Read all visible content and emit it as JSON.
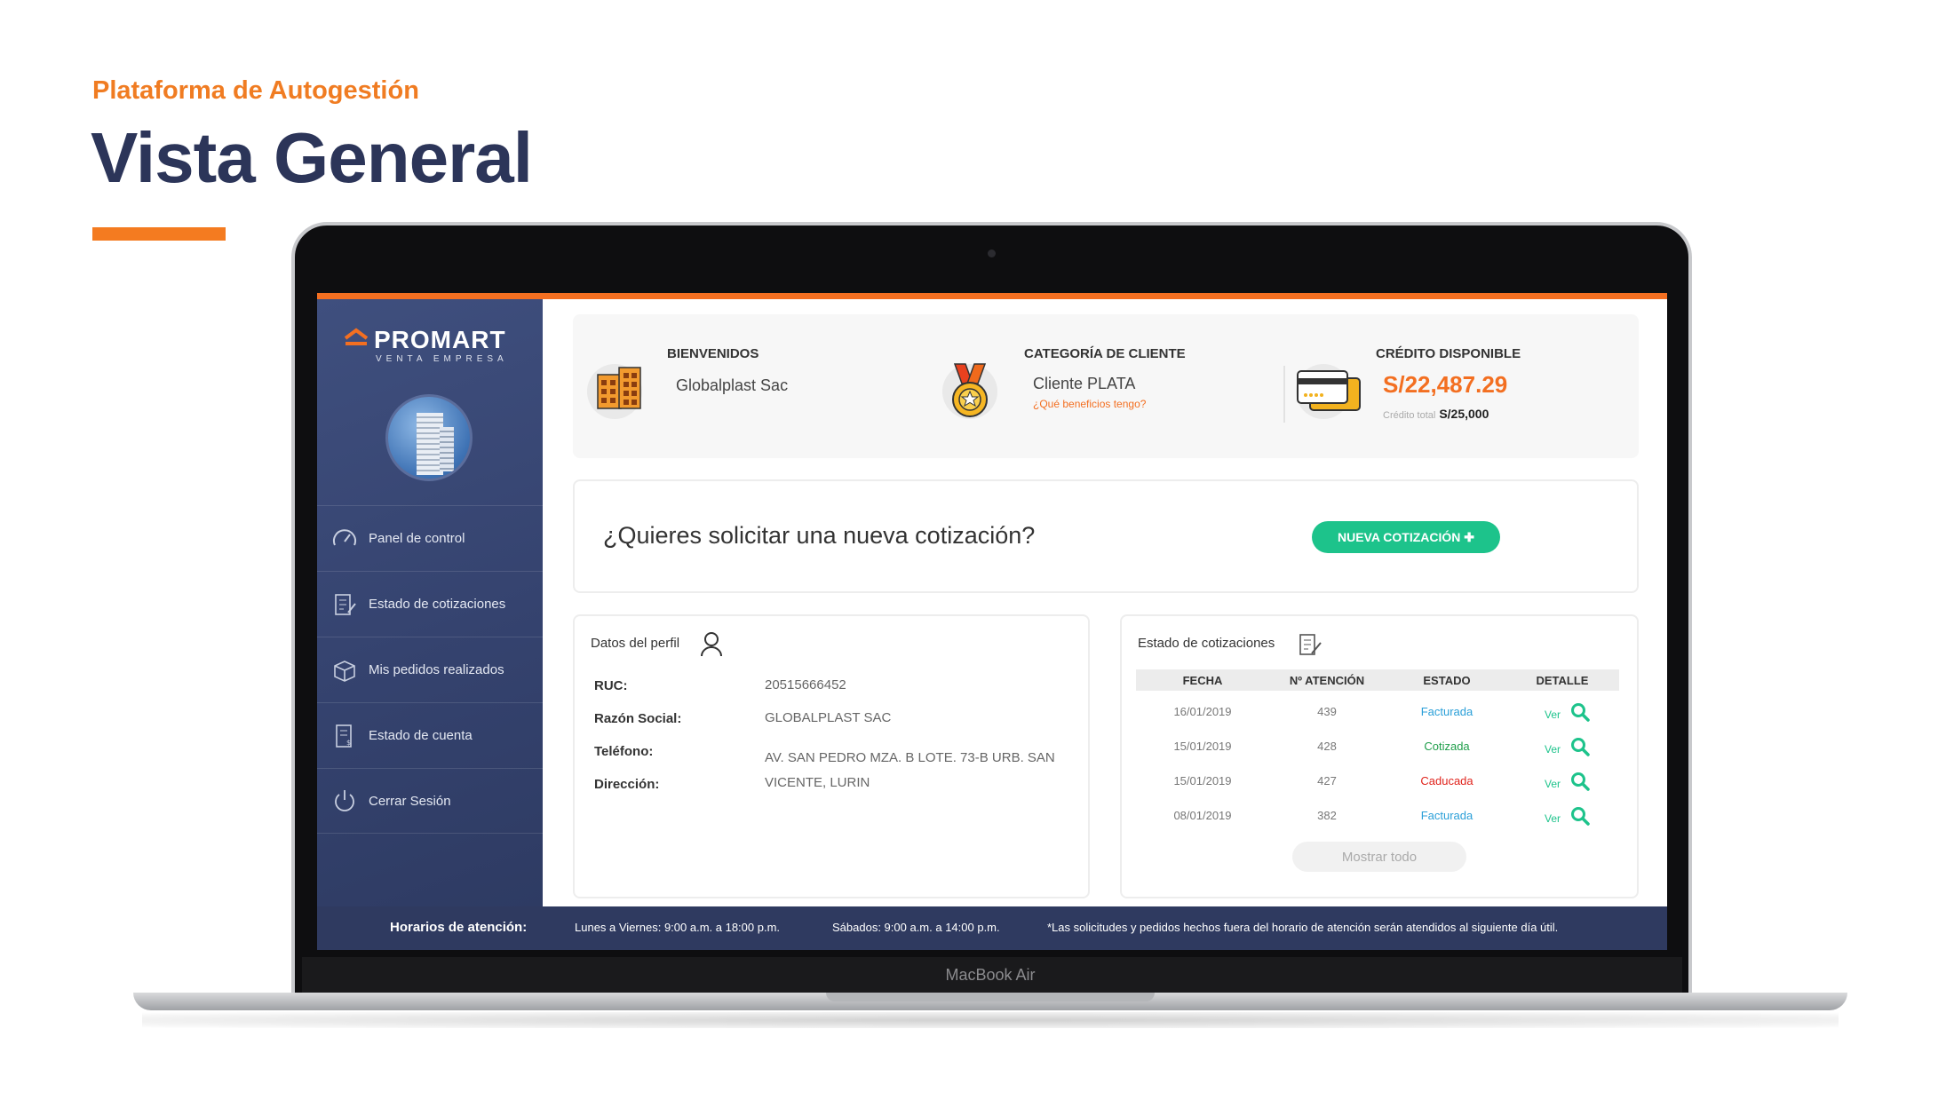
{
  "slide": {
    "eyebrow": "Plataforma de Autogestión",
    "title": "Vista General",
    "accent_color": "#f47b20",
    "title_color": "#2c3559"
  },
  "device": {
    "label": "MacBook Air"
  },
  "brand": {
    "name": "PROMART",
    "subtitle": "VENTA EMPRESA"
  },
  "sidebar": {
    "items": [
      {
        "label": "Panel de control",
        "icon": "speedometer-icon"
      },
      {
        "label": "Estado de cotizaciones",
        "icon": "checklist-icon"
      },
      {
        "label": "Mis pedidos realizados",
        "icon": "box-icon"
      },
      {
        "label": "Estado de cuenta",
        "icon": "statement-icon"
      },
      {
        "label": "Cerrar Sesión",
        "icon": "power-icon"
      }
    ]
  },
  "summary": {
    "welcome_title": "BIENVENIDOS",
    "company": "Globalplast Sac",
    "category_title": "CATEGORÍA DE CLIENTE",
    "category_value": "Cliente PLATA",
    "benefits_link": "¿Qué beneficios tengo?",
    "credit_title": "CRÉDITO DISPONIBLE",
    "credit_available": "S/22,487.29",
    "credit_total_label": "Crédito total",
    "credit_total": "S/25,000"
  },
  "quote_cta": {
    "question": "¿Quieres solicitar una nueva cotización?",
    "button": "NUEVA COTIZACIÓN ✚"
  },
  "profile": {
    "title": "Datos del perfil",
    "fields": [
      {
        "label": "RUC:",
        "value": "20515666452"
      },
      {
        "label": "Razón Social:",
        "value": "GLOBALPLAST SAC"
      },
      {
        "label": "Teléfono:",
        "value": ""
      },
      {
        "label": "Dirección:",
        "value": "AV. SAN PEDRO MZA. B LOTE. 73-B URB. SAN VICENTE, LURIN"
      }
    ]
  },
  "quotes": {
    "title": "Estado de cotizaciones",
    "columns": [
      "FECHA",
      "Nº ATENCIÓN",
      "ESTADO",
      "DETALLE"
    ],
    "rows": [
      {
        "fecha": "16/01/2019",
        "numero": "439",
        "estado": "Facturada",
        "estado_color": "#2a9fd8",
        "detalle": "Ver"
      },
      {
        "fecha": "15/01/2019",
        "numero": "428",
        "estado": "Cotizada",
        "estado_color": "#1f9e4a",
        "detalle": "Ver"
      },
      {
        "fecha": "15/01/2019",
        "numero": "427",
        "estado": "Caducada",
        "estado_color": "#e0231c",
        "detalle": "Ver"
      },
      {
        "fecha": "08/01/2019",
        "numero": "382",
        "estado": "Facturada",
        "estado_color": "#2a9fd8",
        "detalle": "Ver"
      }
    ],
    "show_all": "Mostrar todo"
  },
  "footer": {
    "title": "Horarios de atención:",
    "weekdays": "Lunes a Viernes: 9:00 a.m. a 18:00 p.m.",
    "saturday": "Sábados: 9:00 a.m. a 14:00 p.m.",
    "note": "*Las solicitudes y pedidos hechos fuera del horario de atención serán atendidos al siguiente día útil."
  }
}
